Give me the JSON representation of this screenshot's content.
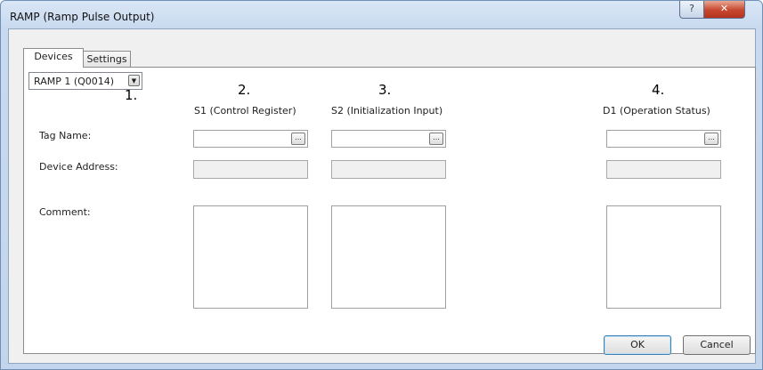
{
  "window": {
    "title": "RAMP (Ramp Pulse Output)",
    "help_button": "?",
    "close_button": "✕"
  },
  "tabs": [
    {
      "label": "Devices",
      "active": true
    },
    {
      "label": "Settings",
      "active": false
    }
  ],
  "instruction_select": {
    "value": "RAMP 1 (Q0014)",
    "dropdown_icon": "▼"
  },
  "annotations": [
    "1.",
    "2.",
    "3.",
    "4."
  ],
  "columns": [
    {
      "header": "S1 (Control Register)"
    },
    {
      "header": "S2 (Initialization Input)"
    },
    {
      "header": "D1 (Operation Status)"
    }
  ],
  "row_labels": {
    "tag_name": "Tag Name:",
    "device_address": "Device Address:",
    "comment": "Comment:"
  },
  "browse_icon": "...",
  "buttons": {
    "ok": "OK",
    "cancel": "Cancel"
  },
  "colors": {
    "title_bar": "#c9daf0",
    "close_button": "#c6472f",
    "dialog_bg": "#f0f0f0"
  }
}
